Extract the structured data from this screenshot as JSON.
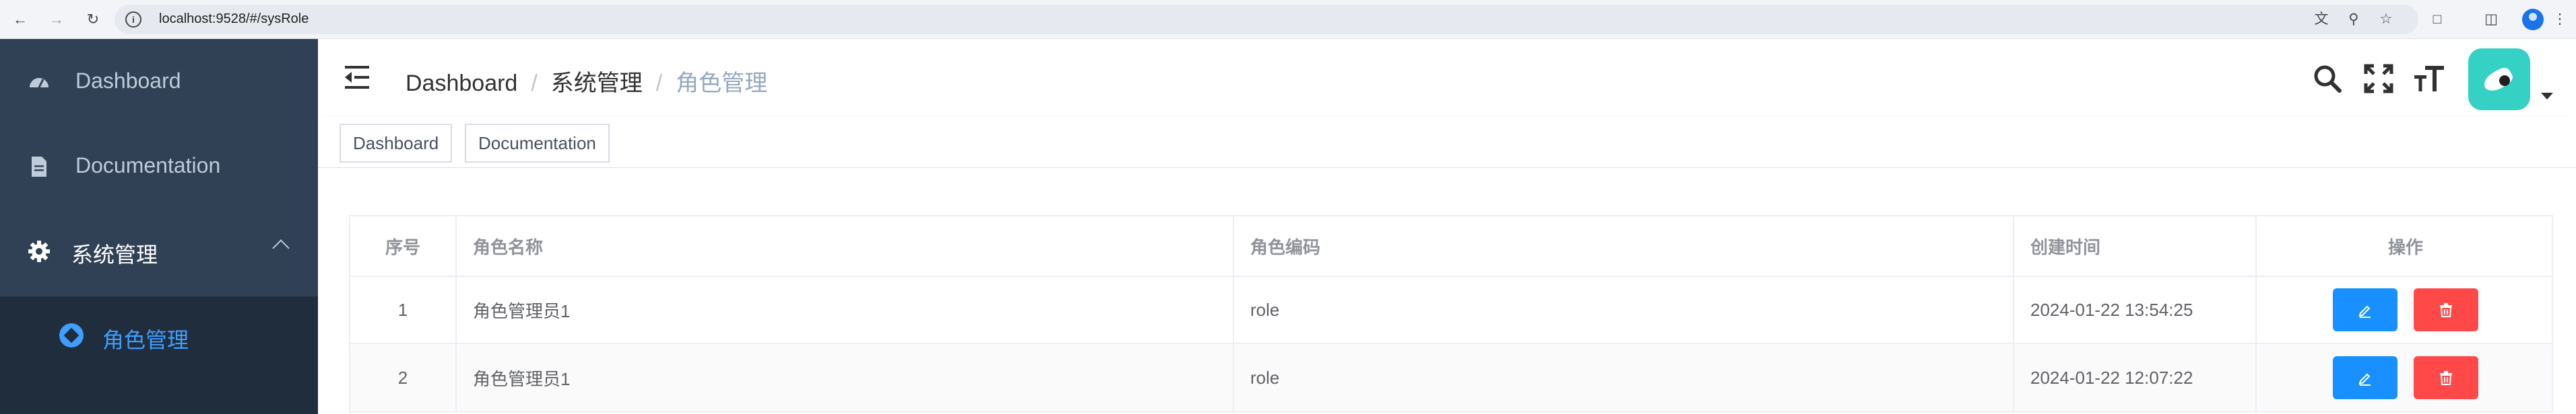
{
  "browser": {
    "url": "localhost:9528/#/sysRole"
  },
  "sidebar": {
    "items": [
      {
        "label": "Dashboard",
        "icon": "dashboard-icon"
      },
      {
        "label": "Documentation",
        "icon": "document-icon"
      },
      {
        "label": "系统管理",
        "icon": "gear-icon",
        "expanded": true
      }
    ],
    "submenu": [
      {
        "label": "角色管理",
        "icon": "role-icon",
        "active": true
      }
    ]
  },
  "navbar": {
    "breadcrumb": [
      "Dashboard",
      "系统管理",
      "角色管理"
    ],
    "separator": "/",
    "icons": [
      "search-icon",
      "fullscreen-icon",
      "font-size-icon"
    ]
  },
  "tags": [
    "Dashboard",
    "Documentation"
  ],
  "table": {
    "columns": [
      "序号",
      "角色名称",
      "角色编码",
      "创建时间",
      "操作"
    ],
    "rows": [
      {
        "index": "1",
        "name": "角色管理员1",
        "code": "role",
        "created": "2024-01-22 13:54:25"
      },
      {
        "index": "2",
        "name": "角色管理员1",
        "code": "role",
        "created": "2024-01-22 12:07:22"
      }
    ]
  },
  "colors": {
    "sidebar_bg": "#304156",
    "submenu_bg": "#1f2d3d",
    "active_accent": "#409eff",
    "edit_button": "#1890ff",
    "delete_button": "#ff4949"
  }
}
